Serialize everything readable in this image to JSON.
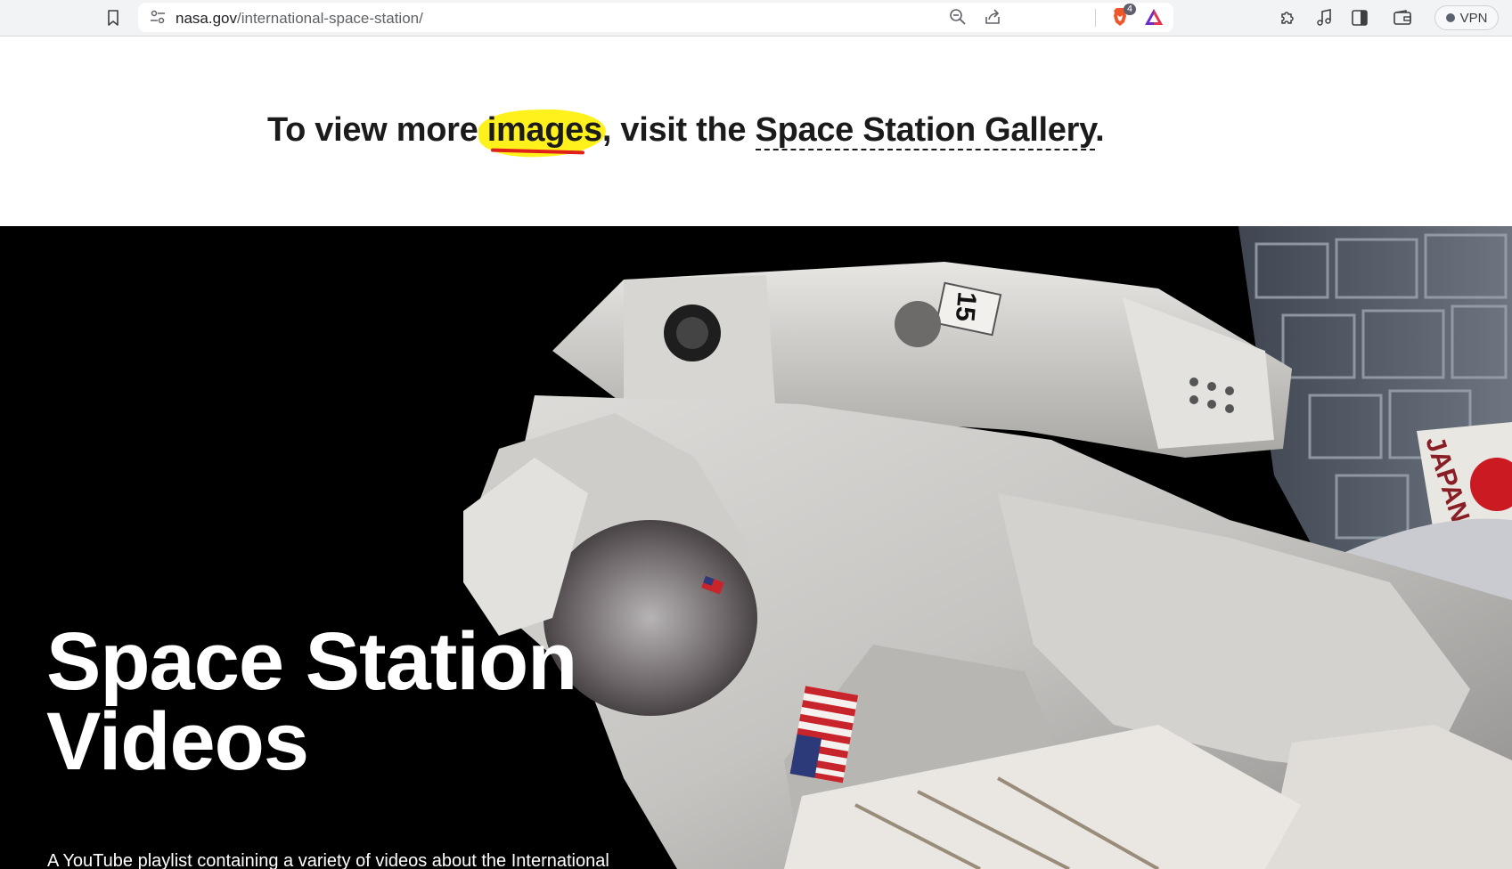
{
  "browser": {
    "url_domain": "nasa.gov",
    "url_path": "/international-space-station/",
    "shields_count": "4",
    "vpn_label": "VPN"
  },
  "gallery": {
    "prefix": "To view more ",
    "highlight": "images",
    "middle": ", visit the ",
    "link_label": "Space Station Gallery",
    "suffix": "."
  },
  "hero": {
    "title_line1": "Space Station",
    "title_line2": "Videos",
    "description": "A YouTube playlist containing a variety of videos about the International",
    "suit_number": "15",
    "module_label": "JAPAN"
  },
  "colors": {
    "highlight": "#fff21c",
    "underline": "#e0201b",
    "hero_bg": "#000000"
  }
}
